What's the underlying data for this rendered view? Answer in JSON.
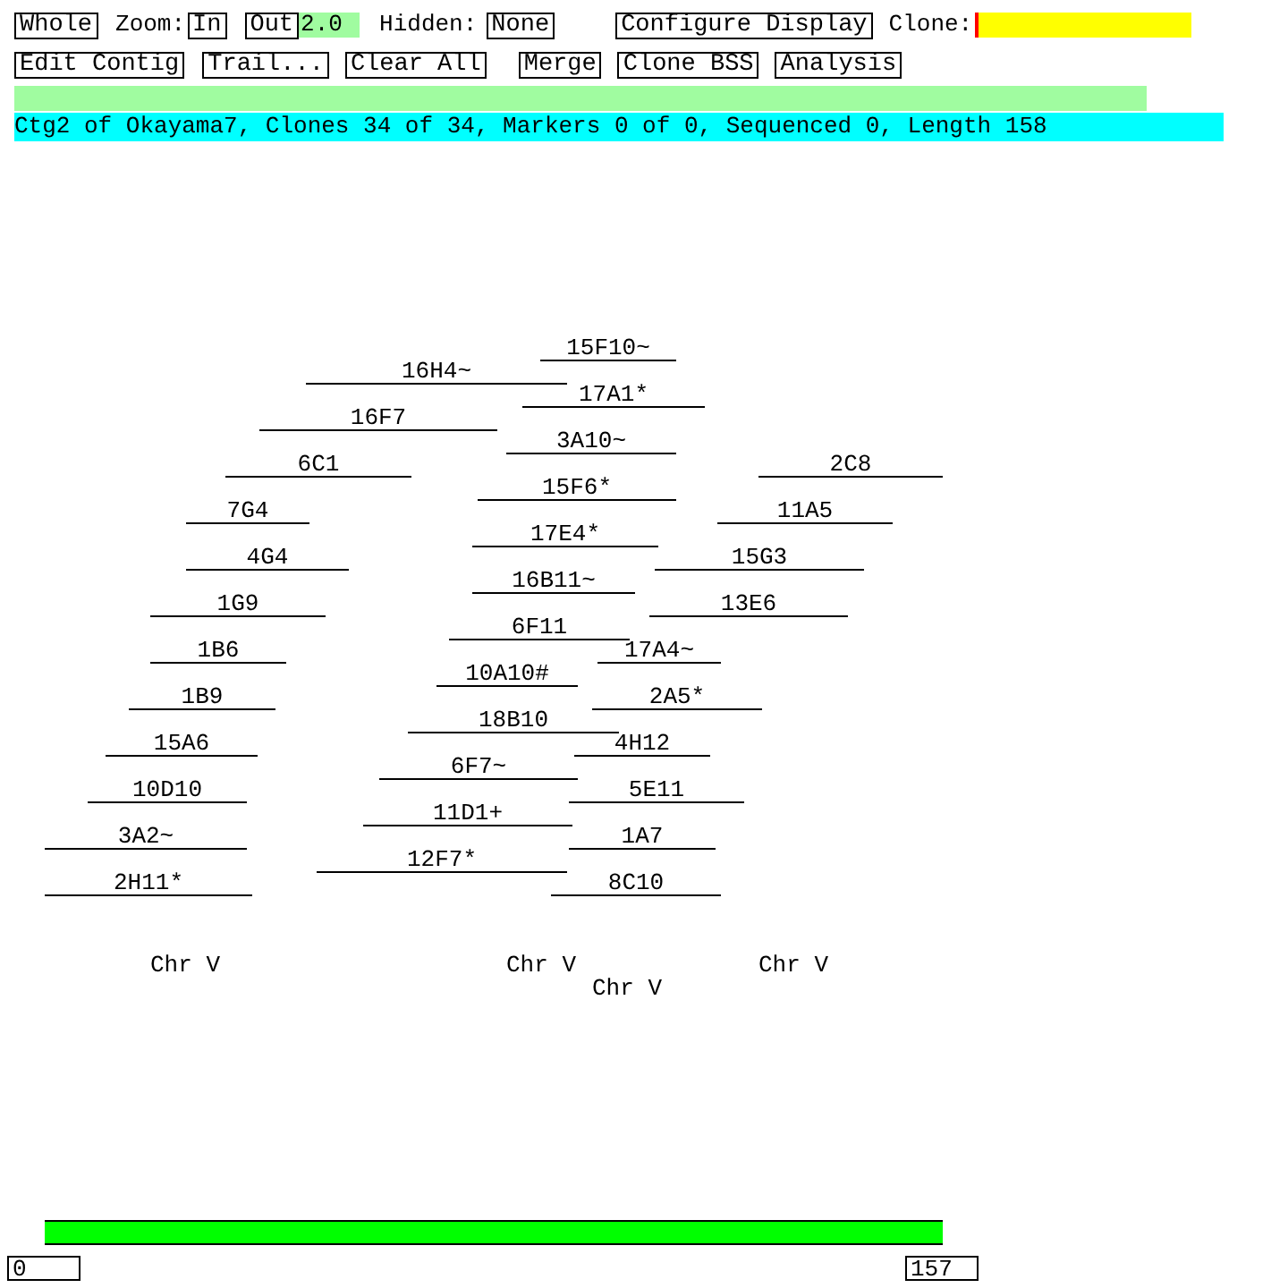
{
  "toolbar": [
    {
      "items": [
        {
          "kind": "button",
          "label": "Whole"
        },
        {
          "kind": "label",
          "text": "Zoom:"
        },
        {
          "kind": "button",
          "label": "In"
        },
        {
          "kind": "button",
          "label": "Out"
        },
        {
          "kind": "field",
          "value": "2.0",
          "color": "#a0fca0",
          "focused": false
        },
        {
          "kind": "label",
          "text": "Hidden:"
        },
        {
          "kind": "button",
          "label": "None"
        },
        {
          "kind": "button",
          "label": "Configure Display"
        },
        {
          "kind": "label",
          "text": "Clone:"
        },
        {
          "kind": "field",
          "color": "#ffff00",
          "focused": true
        }
      ]
    },
    {
      "items": [
        {
          "kind": "button",
          "label": "Edit Contig"
        },
        {
          "kind": "button",
          "label": "Trail..."
        },
        {
          "kind": "button",
          "label": "Clear All"
        },
        {
          "kind": "button",
          "label": "Merge"
        },
        {
          "kind": "button",
          "label": "Clone BSS"
        },
        {
          "kind": "button",
          "label": "Analysis"
        }
      ]
    }
  ],
  "contig_info": "Ctg2 of Okayama7, Clones 34 of 34, Markers 0 of 0, Sequenced 0, Length 158",
  "clones": [
    "15F10~",
    "16H4~",
    "17A1*",
    "16F7",
    "3A10~",
    "6C1",
    "2C8",
    "15F6*",
    "7G4",
    "11A5",
    "17E4*",
    "4G4",
    "15G3",
    "16B11~",
    "1G9",
    "13E6",
    "6F11",
    "1B6",
    "17A4~",
    "10A10#",
    "1B9",
    "2A5*",
    "18B10",
    "15A6",
    "4H12",
    "6F7~",
    "10D10",
    "5E11",
    "11D1+",
    "3A2~",
    "1A7",
    "12F7*",
    "2H11*",
    "8C10"
  ],
  "chromosome_labels": [
    "Chr V",
    "Chr V",
    "Chr V",
    "Chr V"
  ],
  "range": {
    "start": "0",
    "end": "157"
  }
}
